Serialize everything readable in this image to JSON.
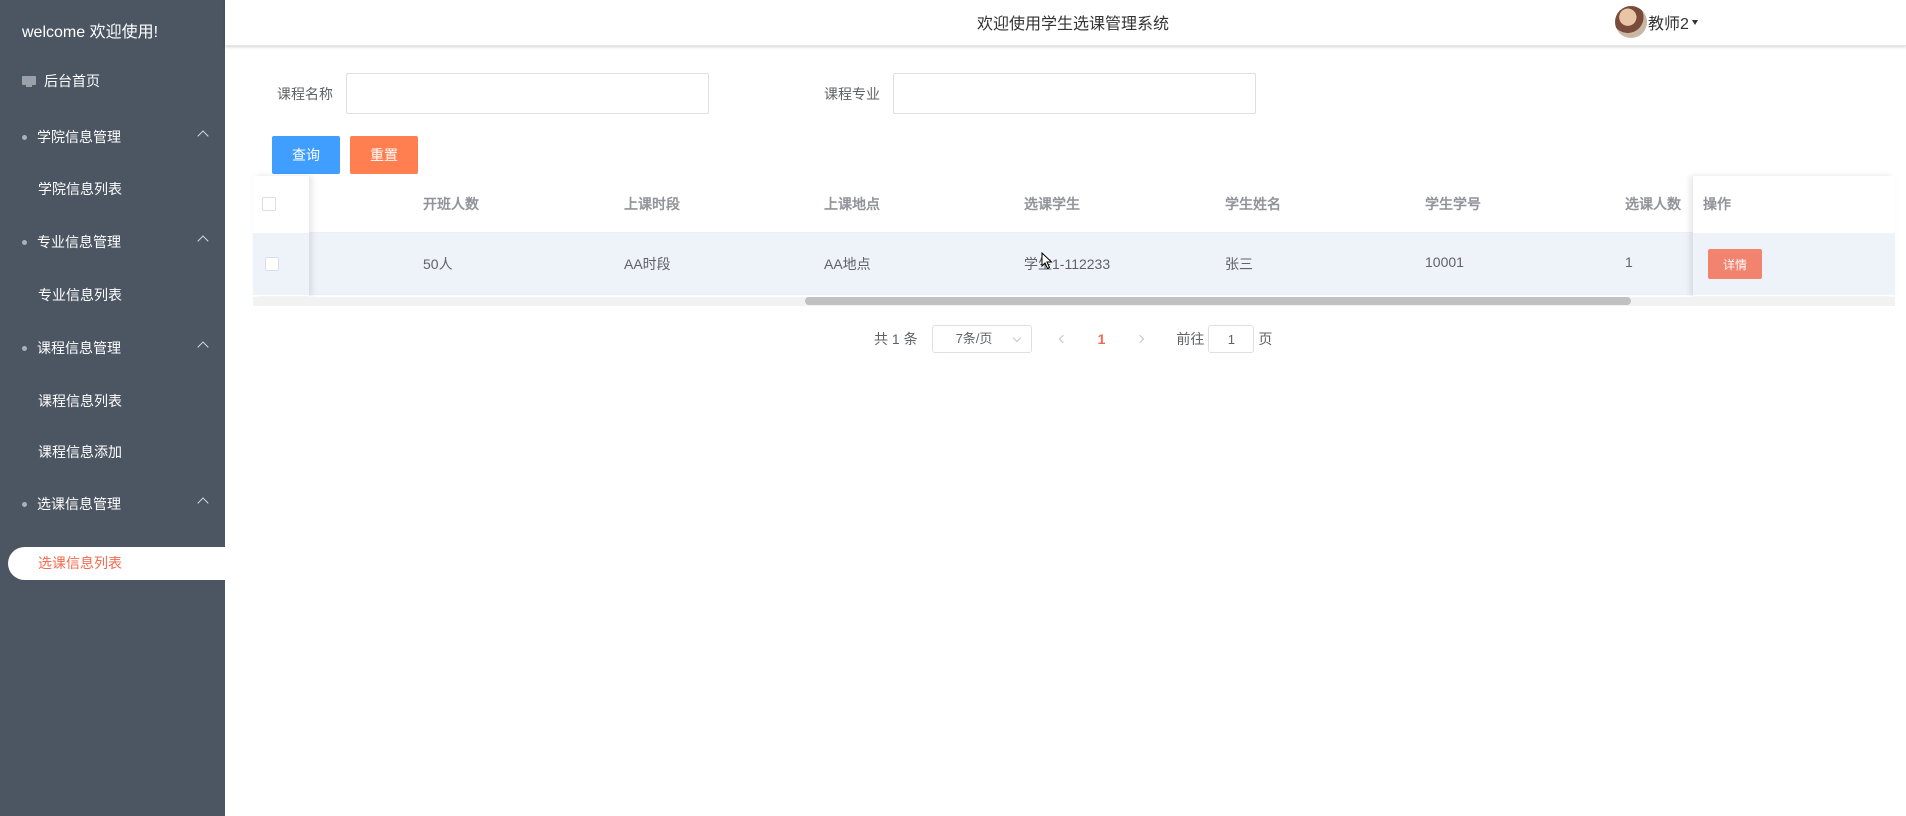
{
  "sidebar": {
    "brand": "welcome 欢迎使用!",
    "home_label": "后台首页",
    "groups": [
      {
        "title": "学院信息管理",
        "items": [
          "学院信息列表"
        ]
      },
      {
        "title": "专业信息管理",
        "items": [
          "专业信息列表"
        ]
      },
      {
        "title": "课程信息管理",
        "items": [
          "课程信息列表",
          "课程信息添加"
        ]
      },
      {
        "title": "选课信息管理",
        "items": [
          "选课信息列表"
        ]
      }
    ]
  },
  "header": {
    "title": "欢迎使用学生选课管理系统",
    "user_name": "教师2"
  },
  "search": {
    "course_name_label": "课程名称",
    "course_name_value": "",
    "major_label": "课程专业",
    "major_value": "",
    "query_button": "查询",
    "reset_button": "重置"
  },
  "table": {
    "columns": [
      "开班人数",
      "上课时段",
      "上课地点",
      "选课学生",
      "学生姓名",
      "学生学号",
      "选课人数",
      "操作"
    ],
    "rows": [
      {
        "class_size": "50人",
        "period": "AA时段",
        "location": "AA地点",
        "student": "学生1-112233",
        "student_name": "张三",
        "student_id": "10001",
        "enroll_count": "1",
        "action": "详情"
      }
    ],
    "scroll_position": 0.55
  },
  "pagination": {
    "total_text": "共 1 条",
    "page_size": "7条/页",
    "current_page": "1",
    "goto_prefix": "前往",
    "goto_value": "1",
    "goto_suffix": "页"
  },
  "colors": {
    "sidebar_bg": "#4c5562",
    "active_accent": "#f4694d",
    "query_button": "#409eff",
    "reset_button": "#ff7f50",
    "row_highlight": "#eef3f9"
  }
}
